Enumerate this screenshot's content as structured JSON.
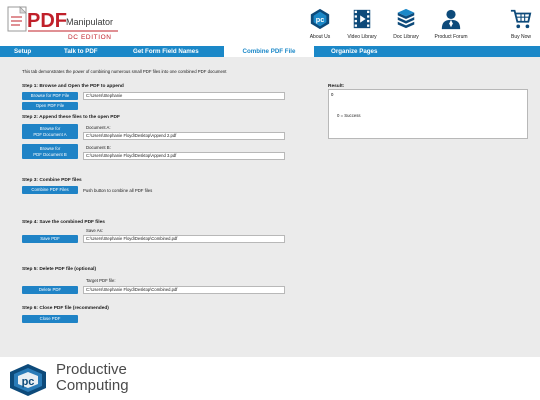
{
  "brand": {
    "logo_text": "PDF",
    "logo_sub": "Manipulator",
    "edition": "DC EDITION"
  },
  "nav": [
    {
      "label": "About Us",
      "icon": "pc-logo-icon"
    },
    {
      "label": "Video Library",
      "icon": "film-icon"
    },
    {
      "label": "Doc Library",
      "icon": "books-icon"
    },
    {
      "label": "Product Forum",
      "icon": "user-icon"
    },
    {
      "label": "Buy Now",
      "icon": "cart-icon"
    }
  ],
  "tabs": [
    "Setup",
    "Talk to PDF",
    "Get Form Field Names",
    "Combine PDF File",
    "Organize Pages"
  ],
  "active_tab": "Combine PDF File",
  "intro": "This tab demonstrates the power of combining numerous small PDF files into one combined PDF document",
  "step1": {
    "title": "Step 1: Browse and Open the PDF to append",
    "browse_label": "Browse for PDF File",
    "path": "C:\\Users\\Stephanie",
    "open_label": "Open PDF File"
  },
  "step2": {
    "title": "Step 2: Append these files to the open PDF",
    "doc_a_btn_line1": "Browse for",
    "doc_a_btn_line2": "PDF Document A",
    "doc_a_label": "Document A:",
    "doc_a_path": "C:\\Users\\Stephanie Floyd\\Desktop\\Append 2.pdf",
    "doc_b_btn_line1": "Browse for",
    "doc_b_btn_line2": "PDF Document B",
    "doc_b_label": "Document B:",
    "doc_b_path": "C:\\Users\\Stephanie Floyd\\Desktop\\Append 3.pdf"
  },
  "step3": {
    "title": "Step 3: Combine PDF files",
    "button": "Combine PDF Files",
    "hint": "Push button to combine all PDF files"
  },
  "step4": {
    "title": "Step 4: Save the combined PDF files",
    "save_as_label": "Save As:",
    "button": "Save PDF",
    "path": "C:\\Users\\Stephanie Floyd\\Desktop\\Combined.pdf"
  },
  "step5": {
    "title": "Step 5: Delete PDF file (optional)",
    "target_label": "Target PDF file:",
    "button": "Delete PDF",
    "path": "C:\\Users\\Stephanie Floyd\\Desktop\\Combined.pdf"
  },
  "step6": {
    "title": "Step 6: Close PDF file (recommended)",
    "button": "Close PDF"
  },
  "result": {
    "label": "Result:",
    "value": "0",
    "legend": "0 = Success"
  },
  "footer": {
    "line1": "Productive",
    "line2": "Computing"
  },
  "colors": {
    "accent": "#1b88c8",
    "brand_red": "#c0202a",
    "nav_dark": "#0d4a7a",
    "panel_bg": "#ebebeb"
  }
}
